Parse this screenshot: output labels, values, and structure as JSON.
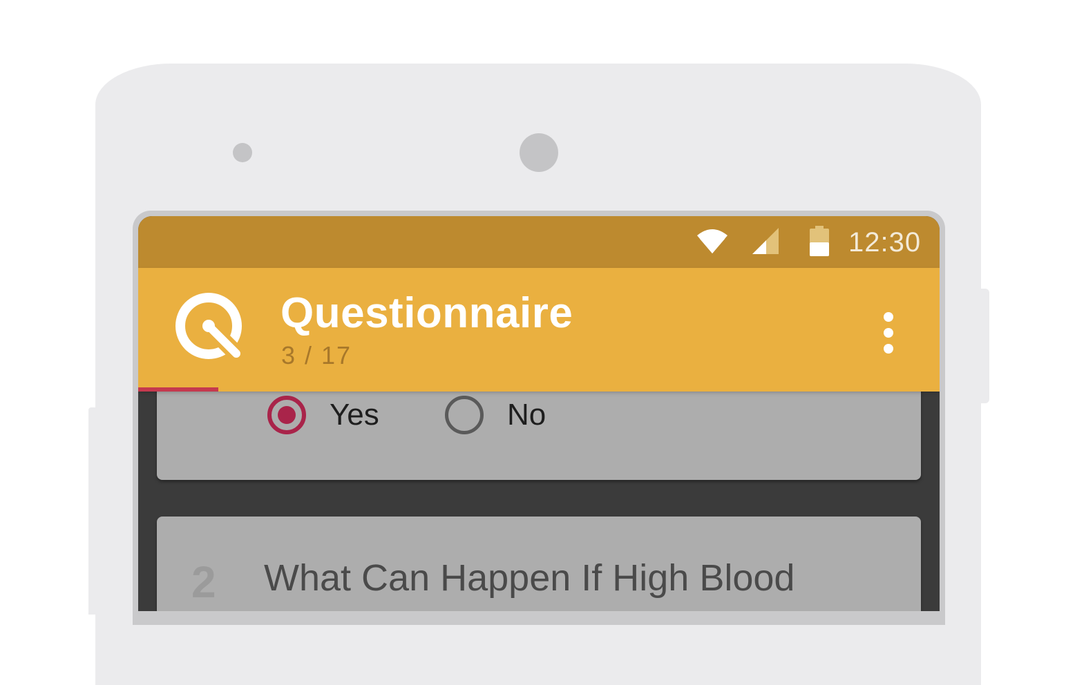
{
  "status_bar": {
    "time": "12:30",
    "icons": [
      "wifi-icon",
      "cell-signal-icon",
      "battery-icon"
    ]
  },
  "app_bar": {
    "title": "Questionnaire",
    "progress_text": "3 / 17",
    "logo_icon": "questionnaire-logo-icon",
    "menu_icon": "more-vert-icon",
    "progress_fraction": 0.1
  },
  "question_1": {
    "options": [
      {
        "label": "Yes",
        "selected": true
      },
      {
        "label": "No",
        "selected": false
      }
    ]
  },
  "question_2": {
    "number": "2",
    "text": "What Can Happen If High Blood"
  },
  "colors": {
    "status_bar": "#bd8a2f",
    "app_bar": "#eab040",
    "accent": "#a9244a",
    "progress": "#c5394e"
  }
}
